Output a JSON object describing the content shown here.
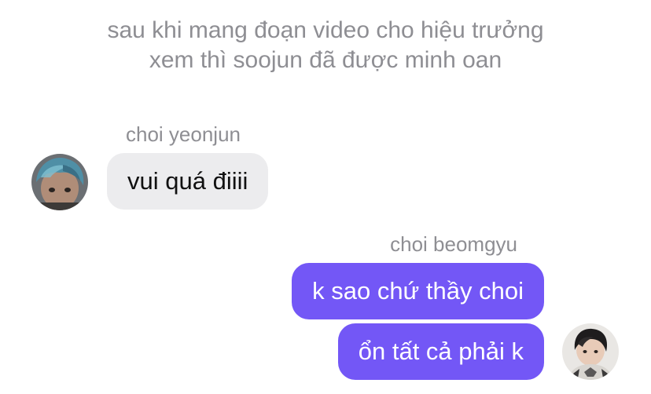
{
  "narration": {
    "line1": "sau khi mang đoạn video cho hiệu trưởng",
    "line2": "xem thì soojun đã được minh oan"
  },
  "messages": [
    {
      "sender": "choi yeonjun",
      "side": "incoming",
      "avatar": "avatar-photo-blue-hair",
      "text": "vui quá điiii"
    },
    {
      "sender": "choi beomgyu",
      "side": "outgoing",
      "avatar": "avatar-photo-dark-hair",
      "texts": [
        "k sao chứ thầy choi",
        "ổn tất cả phải k"
      ]
    }
  ],
  "colors": {
    "incoming_bubble": "#ececee",
    "outgoing_bubble": "#7357f6",
    "meta_text": "#8e8e93"
  }
}
